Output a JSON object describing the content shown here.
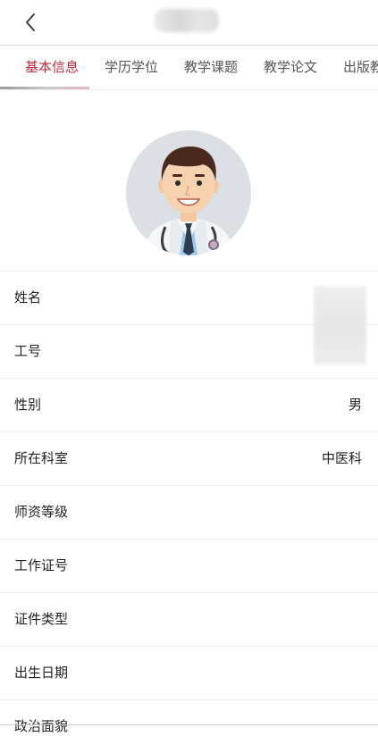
{
  "nav": {
    "title": ""
  },
  "tabs": [
    {
      "label": "基本信息",
      "active": true
    },
    {
      "label": "学历学位",
      "active": false
    },
    {
      "label": "教学课题",
      "active": false
    },
    {
      "label": "教学论文",
      "active": false
    },
    {
      "label": "出版教",
      "active": false
    }
  ],
  "avatar": {
    "icon": "doctor-avatar"
  },
  "fields": [
    {
      "label": "姓名",
      "value": ""
    },
    {
      "label": "工号",
      "value": ""
    },
    {
      "label": "性别",
      "value": "男"
    },
    {
      "label": "所在科室",
      "value": "中医科"
    },
    {
      "label": "师资等级",
      "value": ""
    },
    {
      "label": "工作证号",
      "value": ""
    },
    {
      "label": "证件类型",
      "value": ""
    },
    {
      "label": "出生日期",
      "value": ""
    },
    {
      "label": "政治面貌",
      "value": ""
    }
  ],
  "colors": {
    "accent": "#c0293b",
    "divider": "#ececec"
  }
}
